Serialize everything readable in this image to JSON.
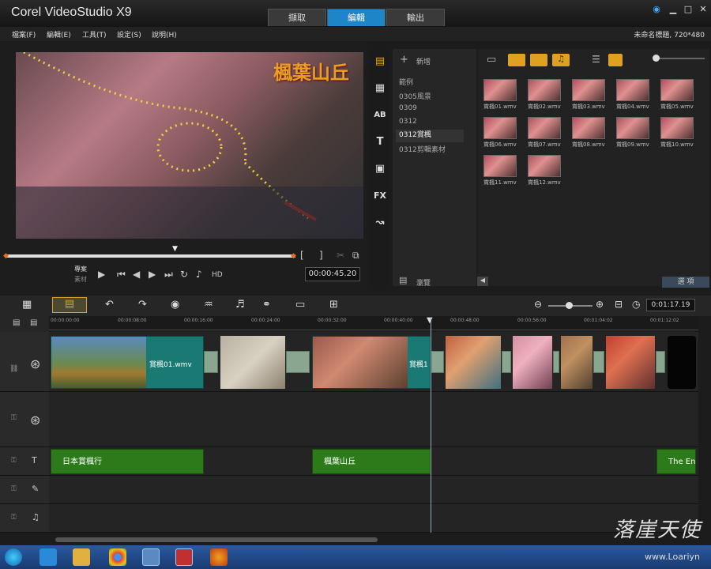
{
  "app": {
    "logo": "Corel VideoStudio X9"
  },
  "tabs": [
    {
      "label": "擷取"
    },
    {
      "label": "編輯"
    },
    {
      "label": "輸出"
    }
  ],
  "menu": [
    {
      "label": "檔案(F)"
    },
    {
      "label": "編輯(E)"
    },
    {
      "label": "工具(T)"
    },
    {
      "label": "設定(S)"
    },
    {
      "label": "說明(H)"
    }
  ],
  "project_info": "未命名標題, 720*480",
  "preview": {
    "overlay_title": "楓葉山丘",
    "mode_project": "專案",
    "mode_clip": "素材",
    "hd_label": "HD",
    "timecode": "00:00:45.20"
  },
  "library": {
    "add_label": "新增",
    "browse_label": "瀏覽",
    "options_label": "選 項",
    "folders": [
      {
        "label": "範例"
      },
      {
        "label": "0305風景"
      },
      {
        "label": "0309"
      },
      {
        "label": "0312"
      },
      {
        "label": "0312賞楓"
      },
      {
        "label": "0312剪輯素材"
      }
    ],
    "thumbnails": [
      {
        "label": "賞楓01.wmv"
      },
      {
        "label": "賞楓02.wmv"
      },
      {
        "label": "賞楓03.wmv"
      },
      {
        "label": "賞楓04.wmv"
      },
      {
        "label": "賞楓05.wmv"
      },
      {
        "label": "賞楓06.wmv"
      },
      {
        "label": "賞楓07.wmv"
      },
      {
        "label": "賞楓08.wmv"
      },
      {
        "label": "賞楓09.wmv"
      },
      {
        "label": "賞楓10.wmv"
      },
      {
        "label": "賞楓11.wmv"
      },
      {
        "label": "賞楓12.wmv"
      }
    ]
  },
  "timeline": {
    "duration": "0:01:17.19",
    "ruler": [
      "00:00:00:00",
      "00:00:08:00",
      "00:00:16:00",
      "00:00:24:00",
      "00:00:32:00",
      "00:00:40:00",
      "00:00:48:00",
      "00:00:56:00",
      "00:01:04:02",
      "00:01:12:02"
    ],
    "video_clip_1": "賞楓01.wmv",
    "video_clip_2": "賞楓1",
    "title_clips": [
      {
        "label": "日本賞楓行"
      },
      {
        "label": "楓葉山丘"
      },
      {
        "label": "The End"
      }
    ]
  },
  "watermark": {
    "text": "落崖天使",
    "url": "www.Loariyn"
  }
}
